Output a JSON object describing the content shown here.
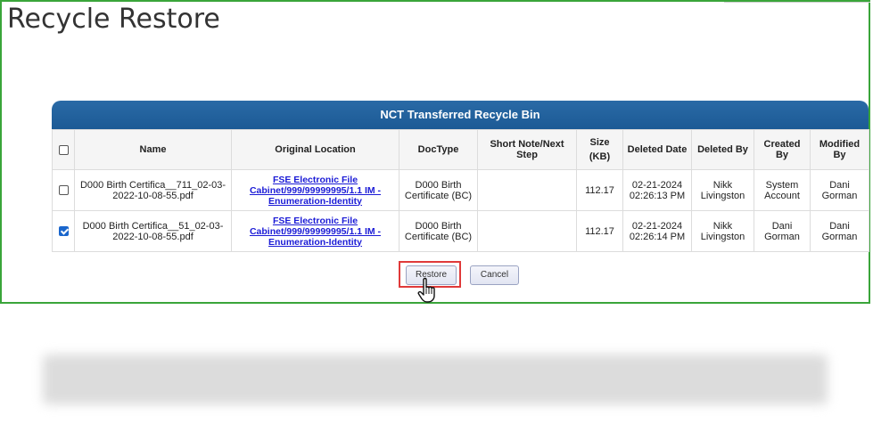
{
  "page": {
    "title": "Recycle Restore"
  },
  "panel": {
    "title": "NCT Transferred Recycle Bin"
  },
  "table": {
    "headers": {
      "name": "Name",
      "location": "Original Location",
      "doctype": "DocType",
      "note": "Short Note/Next Step",
      "size_1": "Size",
      "size_2": "(KB)",
      "deleted_date": "Deleted Date",
      "deleted_by": "Deleted By",
      "created_by": "Created By",
      "modified_by": "Modified By"
    },
    "rows": [
      {
        "checked": false,
        "name_1": "D000 Birth Certifica__711_02-03-",
        "name_2": "2022-10-08-55.pdf",
        "loc_1": "FSE Electronic File",
        "loc_2": "Cabinet/999/99999995/1.1 IM -",
        "loc_3": "Enumeration-Identity",
        "doctype_1": "D000 Birth",
        "doctype_2": "Certificate (BC)",
        "note": "",
        "size": "112.17",
        "date_1": "02-21-2024",
        "date_2": "02:26:13 PM",
        "deleted_by_1": "Nikk",
        "deleted_by_2": "Livingston",
        "created_by_1": "System",
        "created_by_2": "Account",
        "modified_by_1": "Dani",
        "modified_by_2": "Gorman"
      },
      {
        "checked": true,
        "name_1": "D000 Birth Certifica__51_02-03-",
        "name_2": "2022-10-08-55.pdf",
        "loc_1": "FSE Electronic File",
        "loc_2": "Cabinet/999/99999995/1.1 IM -",
        "loc_3": "Enumeration-Identity",
        "doctype_1": "D000 Birth",
        "doctype_2": "Certificate (BC)",
        "note": "",
        "size": "112.17",
        "date_1": "02-21-2024",
        "date_2": "02:26:14 PM",
        "deleted_by_1": "Nikk",
        "deleted_by_2": "Livingston",
        "created_by_1": "Dani",
        "created_by_2": "Gorman",
        "modified_by_1": "Dani",
        "modified_by_2": "Gorman"
      }
    ]
  },
  "buttons": {
    "restore": "Restore",
    "cancel": "Cancel"
  },
  "icons": {
    "cursor": "hand-pointer-icon",
    "checkbox": "checkbox-icon"
  },
  "colors": {
    "panel_header": "#1c5a95",
    "frame_border": "#3aa53a",
    "highlight_border": "#e03a3a",
    "link": "#1b1bd6",
    "checkbox_checked": "#1a66cc"
  }
}
